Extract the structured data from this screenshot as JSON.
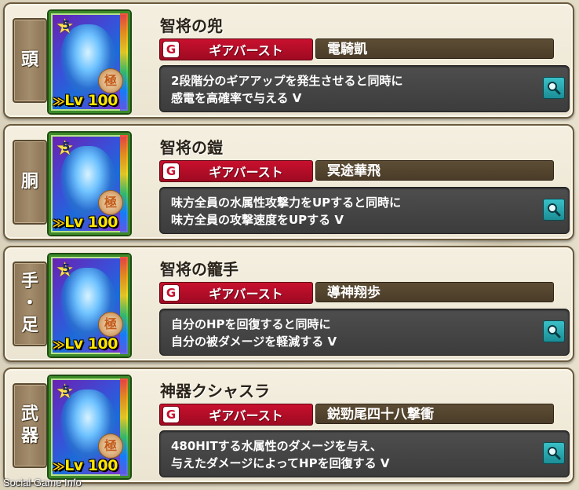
{
  "equipment": [
    {
      "slot_chars": [
        "頭"
      ],
      "level_text": "Lv 100",
      "star_rank": "5",
      "medal_char": "極",
      "name": "智将の兜",
      "gear_burst_label": "ギアバースト",
      "skill_name": "電騎凱",
      "description": [
        "2段階分のギアアップを発生させると同時に",
        "感電を高確率で与える V"
      ]
    },
    {
      "slot_chars": [
        "胴"
      ],
      "level_text": "Lv 100",
      "star_rank": "5",
      "medal_char": "極",
      "name": "智将の鎧",
      "gear_burst_label": "ギアバースト",
      "skill_name": "冥途華飛",
      "description": [
        "味方全員の水属性攻撃力をUPすると同時に",
        "味方全員の攻撃速度をUPする V"
      ]
    },
    {
      "slot_chars": [
        "手",
        "・",
        "足"
      ],
      "level_text": "Lv 100",
      "star_rank": "5",
      "medal_char": "極",
      "name": "智将の籠手",
      "gear_burst_label": "ギアバースト",
      "skill_name": "導神翔歩",
      "description": [
        "自分のHPを回復すると同時に",
        "自分の被ダメージを軽減する V"
      ]
    },
    {
      "slot_chars": [
        "武",
        "器"
      ],
      "level_text": "Lv 100",
      "star_rank": "5",
      "medal_char": "極",
      "name": "神器クシャスラ",
      "gear_burst_label": "ギアバースト",
      "skill_name": "鋭勁尾四十八撃衝",
      "description": [
        "480HITする水属性のダメージを与え、",
        "与えたダメージによってHPを回復する V"
      ]
    }
  ],
  "watermark": "Social Game Info",
  "icons": {
    "gear_burst": "g-icon",
    "detail": "magnifier-icon",
    "rarity": "star-icon",
    "level": "double-arrow-mark"
  },
  "colors": {
    "gear_burst_red": "#c8102e",
    "skill_name_bg": "#4a3c28",
    "desc_bg": "#3c3c3c",
    "level_yellow": "#ffe600",
    "magnifier_teal": "#1b8e96"
  }
}
